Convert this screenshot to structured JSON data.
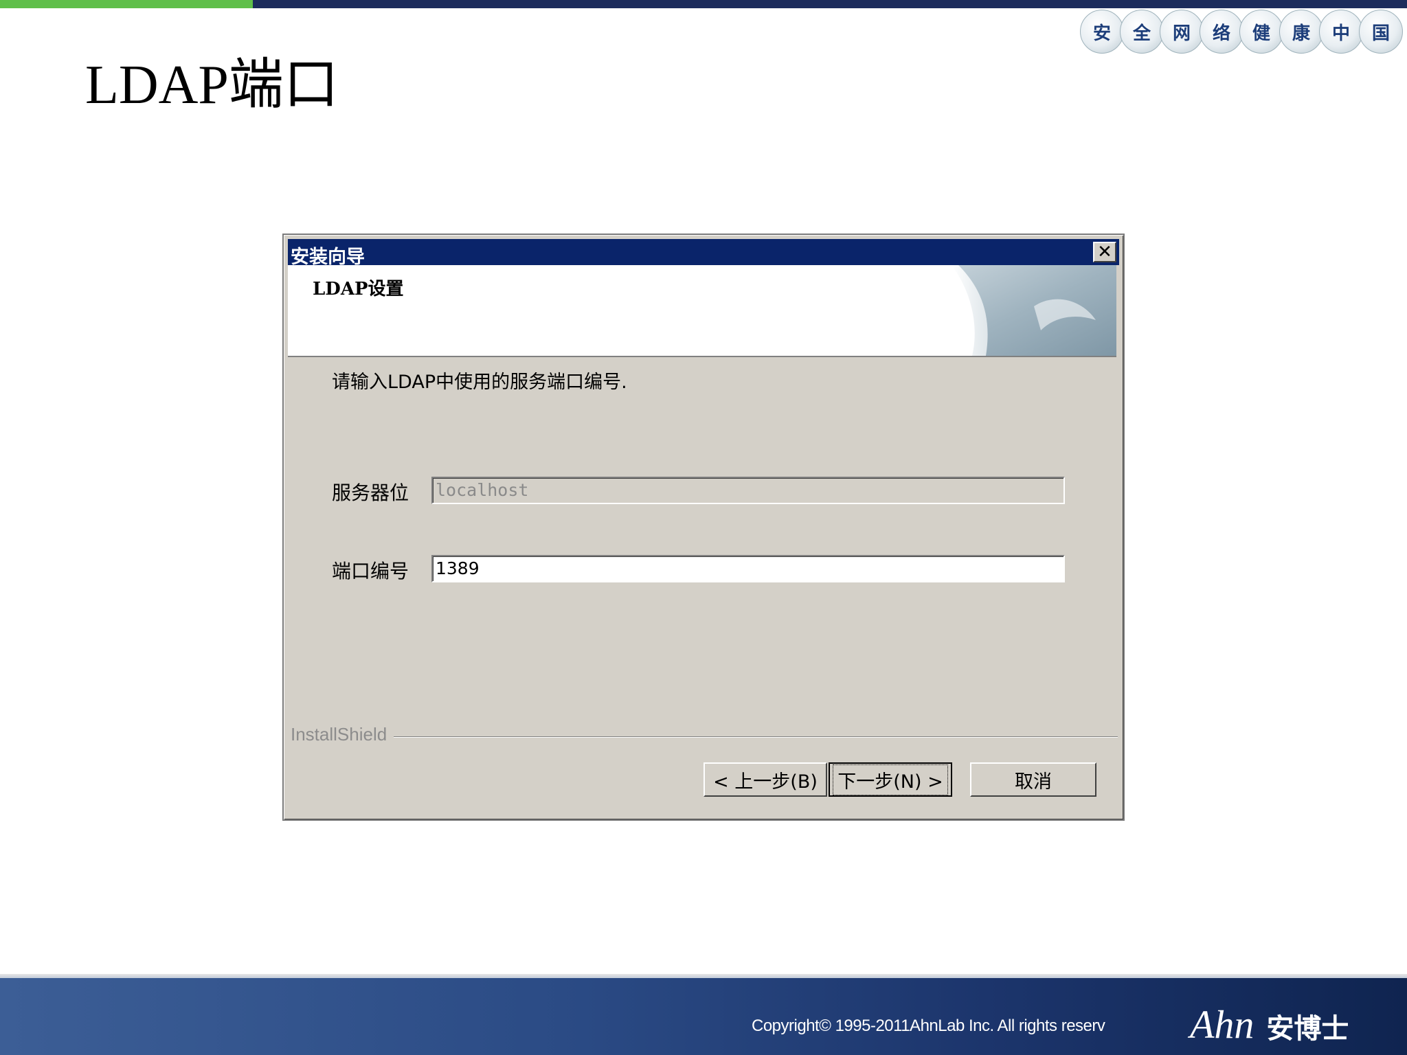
{
  "badges": [
    "安",
    "全",
    "网",
    "络",
    "健",
    "康",
    "中",
    "国"
  ],
  "slide": {
    "title": "LDAP端口"
  },
  "dialog": {
    "title": "安装向导",
    "close_glyph": "✕",
    "header_title": "LDAP设置",
    "instruction": "请输入LDAP中使用的服务端口编号.",
    "fields": {
      "server_label": "服务器位",
      "server_value": "localhost",
      "port_label": "端口编号",
      "port_value": "1389"
    },
    "brand": "InstallShield",
    "buttons": {
      "back": "< 上一步(B)",
      "next": "下一步(N) >",
      "cancel": "取消"
    }
  },
  "footer": {
    "copyright": "Copyright© 1995-2011AhnLab Inc. All rights reserv",
    "logo_mark": "Ahn",
    "logo_cn": "安博士"
  },
  "colors": {
    "title_bar": "#0a246a",
    "dialog_bg": "#d4d0c8",
    "accent_green": "#5fbf4a",
    "footer_blue": "#1c356c"
  }
}
